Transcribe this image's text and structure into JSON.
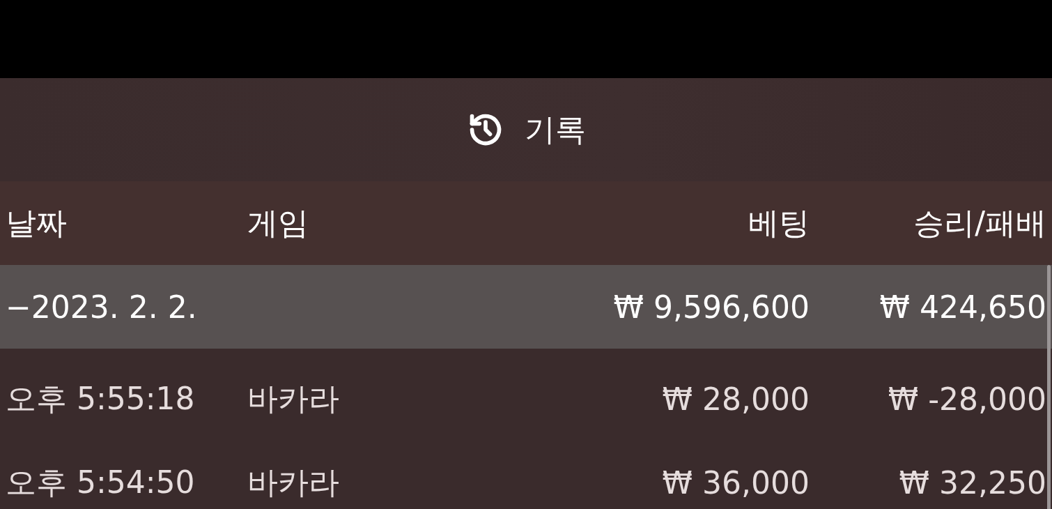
{
  "title": "기록",
  "columns": [
    "날짜",
    "게임",
    "베팅",
    "승리/패배"
  ],
  "groups": [
    {
      "date": "−2023. 2. 2.",
      "bet": "₩ 9,596,600",
      "result": "₩ 424,650",
      "rows": [
        {
          "time": "오후 5:55:18",
          "game": "바카라",
          "bet": "₩ 28,000",
          "result": "₩ -28,000"
        },
        {
          "time": "오후 5:54:50",
          "game": "바카라",
          "bet": "₩ 36,000",
          "result": "₩ 32,250"
        }
      ]
    }
  ]
}
